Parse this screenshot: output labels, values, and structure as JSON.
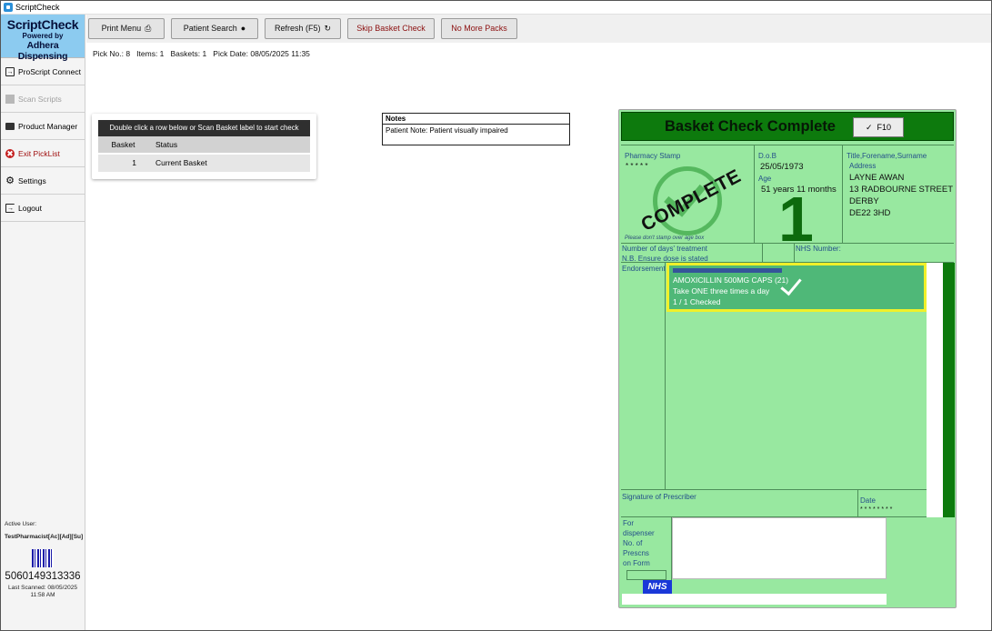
{
  "window": {
    "title": "ScriptCheck"
  },
  "sidebar": {
    "logo_title": "ScriptCheck",
    "logo_powered": "Powered by",
    "logo_brand": "Adhera Dispensing",
    "items": [
      {
        "label": "ProScript Connect",
        "icon": "login-icon"
      },
      {
        "label": "Scan Scripts",
        "icon": "scan-icon"
      },
      {
        "label": "Product Manager",
        "icon": "folder-icon"
      },
      {
        "label": "Exit PickList",
        "icon": "exit-icon"
      },
      {
        "label": "Settings",
        "icon": "gear-icon"
      },
      {
        "label": "Logout",
        "icon": "logout-icon"
      }
    ],
    "active_user_label": "Active User:",
    "active_user": "TestPharmacist[Ac][Ad][Su]",
    "scanned_code": "5060149313336",
    "last_scanned_line1": "Last Scanned: 08/05/2025",
    "last_scanned_line2": "11:58 AM"
  },
  "toolbar": {
    "print_menu": "Print Menu",
    "patient_search": "Patient Search",
    "refresh": "Refresh (F5)",
    "skip_basket_check": "Skip Basket Check",
    "no_more_packs": "No More Packs"
  },
  "pick_info": "Pick No.: 8   Items: 1   Baskets: 1   Pick Date: 08/05/2025 11:35",
  "basket_panel": {
    "header": "Double click a row below or Scan Basket label to start check",
    "col_basket": "Basket",
    "col_status": "Status",
    "rows": [
      {
        "basket": "1",
        "status": "Current Basket"
      }
    ]
  },
  "notes": {
    "title": "Notes",
    "text": "Patient Note:  Patient visually impaired"
  },
  "form": {
    "header_title": "Basket Check Complete",
    "f10_label": "F10",
    "pharmacy_stamp_label": "Pharmacy Stamp",
    "pharmacy_stamp_value": "* * * * *",
    "stamp_word": "COMPLETE",
    "stamp_note": "Please don't stamp over age box",
    "dob_label": "D.o.B",
    "dob": "25/05/1973",
    "age_label": "Age",
    "age": "51 years 11 months",
    "big_number": "1",
    "name_label": "Title,Forename,Surname",
    "address_label": "Address",
    "patient_name": "LAYNE AWAN",
    "address_line1": "13 RADBOURNE STREET",
    "address_line2": "DERBY",
    "postcode": "DE22 3HD",
    "days_treatment": "Number of days' treatment",
    "ensure_dose": "N.B. Ensure dose is stated",
    "nhs_number_label": "NHS Number:",
    "endorsements_label": "Endorsements",
    "item_name": "AMOXICILLIN 500MG CAPS (21)",
    "item_dose": "Take ONE three times a day",
    "item_checked": "1 / 1 Checked",
    "signature_label": "Signature of Prescriber",
    "date_label": "Date",
    "date_value": "* * * * * * * *",
    "for_dispenser": "For",
    "dispenser": "dispenser",
    "no_of": "No. of",
    "prescns": "Prescns",
    "on_form": "on Form",
    "nhs_logo": "NHS"
  },
  "colors": {
    "accent_blue": "#8ccbf0",
    "form_green": "#98e8a0",
    "header_green": "#0d7a0d",
    "item_green": "#4fb878",
    "highlight_yellow": "#f0f02a",
    "nhs_blue": "#1a38d8"
  }
}
